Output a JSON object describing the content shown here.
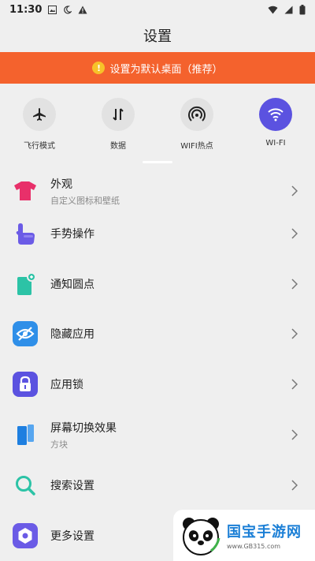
{
  "status_bar": {
    "time": "11:30",
    "icons_left": [
      "image-icon",
      "moon-icon",
      "warning-icon"
    ],
    "icons_right": [
      "wifi-icon",
      "signal-icon",
      "battery-icon"
    ]
  },
  "header": {
    "title": "设置"
  },
  "banner": {
    "icon": "!",
    "text": "设置为默认桌面（推荐）",
    "color": "#f4622d"
  },
  "quick_toggles": [
    {
      "label": "飞行模式",
      "icon": "airplane-icon",
      "active": false
    },
    {
      "label": "数据",
      "icon": "data-arrows-icon",
      "active": false
    },
    {
      "label": "WIFI热点",
      "icon": "hotspot-icon",
      "active": false
    },
    {
      "label": "WI-FI",
      "icon": "wifi-icon",
      "active": true
    }
  ],
  "accent_color": "#5b52e0",
  "settings": [
    {
      "title": "外观",
      "subtitle": "自定义图标和壁纸",
      "icon": "tshirt-icon"
    },
    {
      "title": "手势操作",
      "subtitle": "",
      "icon": "gesture-hand-icon"
    },
    {
      "title": "通知圆点",
      "subtitle": "",
      "icon": "notification-dot-icon"
    },
    {
      "title": "隐藏应用",
      "subtitle": "",
      "icon": "hide-eye-icon"
    },
    {
      "title": "应用锁",
      "subtitle": "",
      "icon": "lock-icon"
    },
    {
      "title": "屏幕切换效果",
      "subtitle": "方块",
      "icon": "screen-transition-icon"
    },
    {
      "title": "搜索设置",
      "subtitle": "",
      "icon": "search-icon"
    },
    {
      "title": "更多设置",
      "subtitle": "",
      "icon": "more-settings-icon"
    }
  ],
  "watermark": {
    "title": "国宝手游网",
    "url": "www.GB315.com"
  }
}
